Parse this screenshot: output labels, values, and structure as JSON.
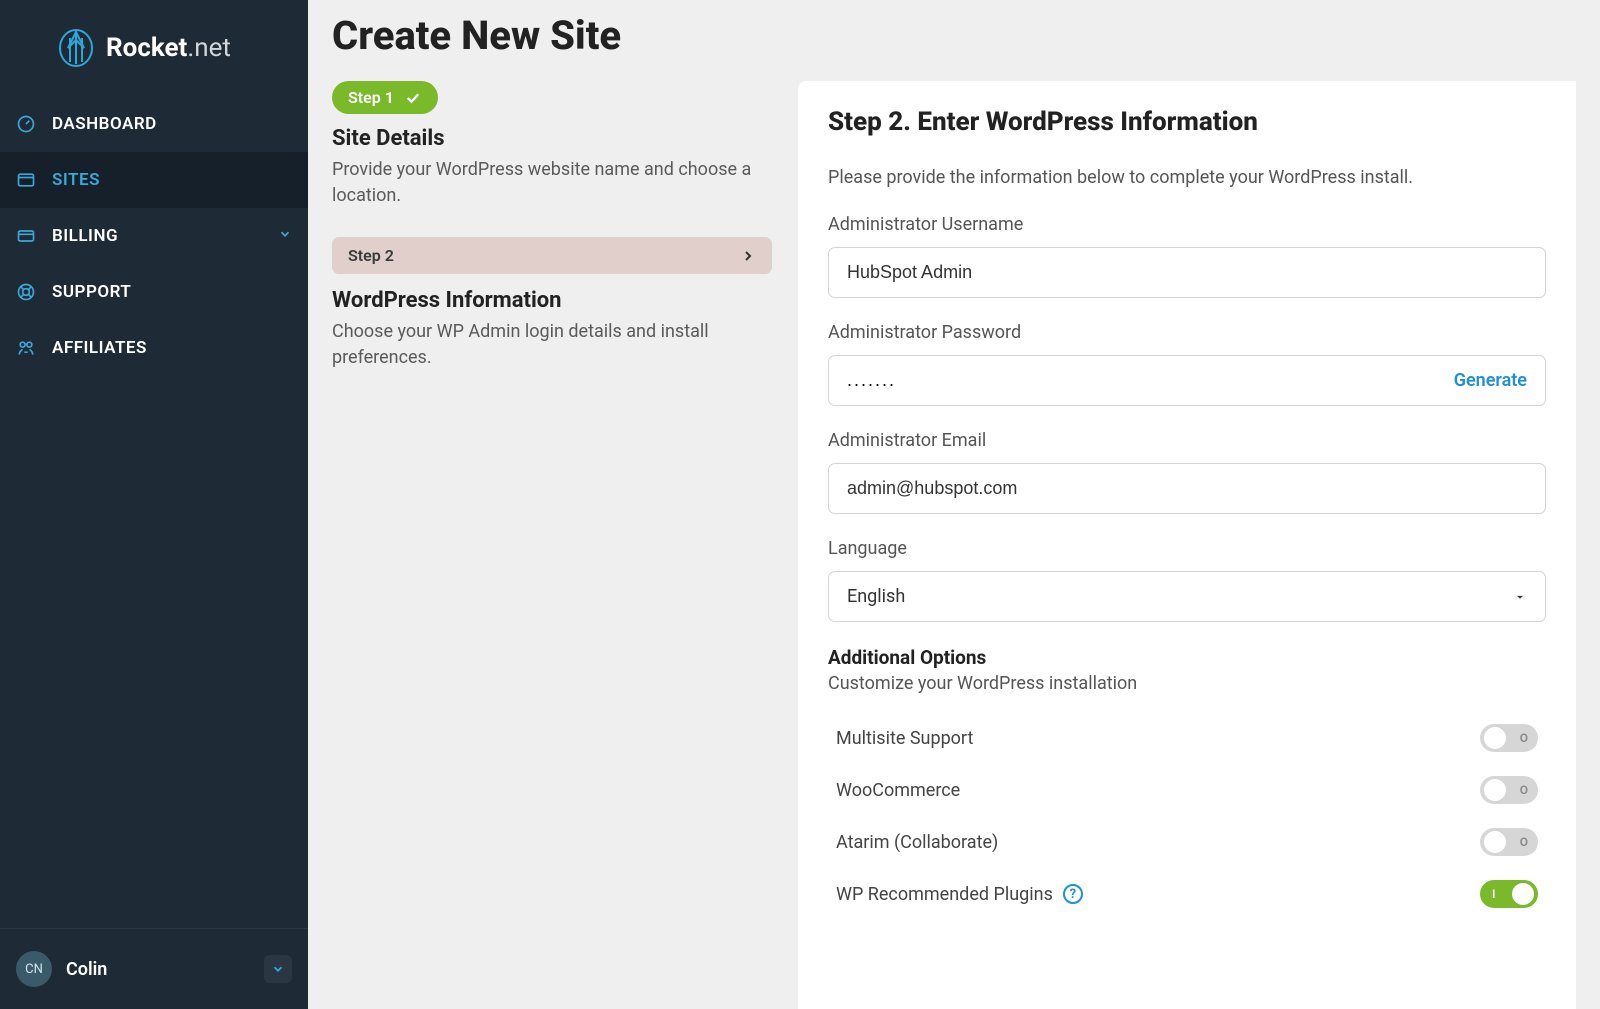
{
  "brand": {
    "name_bold": "Rocket",
    "name_light": ".net"
  },
  "nav": {
    "dashboard": "DASHBOARD",
    "sites": "SITES",
    "billing": "BILLING",
    "support": "SUPPORT",
    "affiliates": "AFFILIATES"
  },
  "user": {
    "initials": "CN",
    "name": "Colin"
  },
  "page": {
    "title": "Create New Site"
  },
  "steps": {
    "s1_badge": "Step 1",
    "s1_title": "Site Details",
    "s1_desc": "Provide your WordPress website name and choose a location.",
    "s2_row": "Step 2",
    "s2_title": "WordPress Information",
    "s2_desc": "Choose your WP Admin login details and install preferences."
  },
  "panel": {
    "title": "Step 2. Enter WordPress Information",
    "intro": "Please provide the information below to complete your WordPress install.",
    "username_label": "Administrator Username",
    "username_value": "HubSpot Admin",
    "password_label": "Administrator Password",
    "password_value": ".......",
    "generate": "Generate",
    "email_label": "Administrator Email",
    "email_value": "admin@hubspot.com",
    "language_label": "Language",
    "language_value": "English",
    "additional_title": "Additional Options",
    "additional_desc": "Customize your WordPress installation",
    "options": {
      "multisite": "Multisite Support",
      "woocommerce": "WooCommerce",
      "atarim": "Atarim (Collaborate)",
      "wprec": "WP Recommended Plugins"
    },
    "toggle_off_hint": "O",
    "toggle_on_hint": "I"
  }
}
